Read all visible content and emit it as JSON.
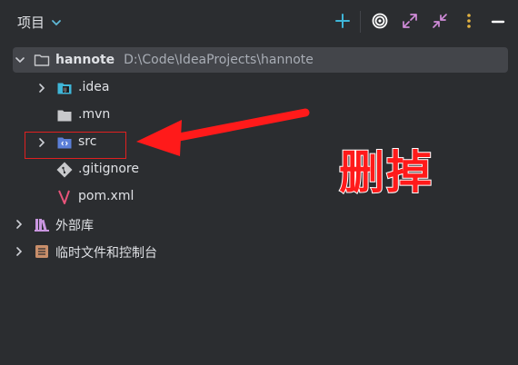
{
  "header": {
    "title": "项目"
  },
  "tree": {
    "root": {
      "name": "hannote",
      "path": "D:\\Code\\IdeaProjects\\hannote"
    },
    "items": [
      {
        "label": ".idea"
      },
      {
        "label": ".mvn"
      },
      {
        "label": "src"
      },
      {
        "label": ".gitignore"
      },
      {
        "label": "pom.xml"
      }
    ],
    "external_libs": "外部库",
    "scratches": "临时文件和控制台"
  },
  "annotation": {
    "text": "删掉"
  },
  "colors": {
    "background": "#2b2d30",
    "selected_row": "#43454a",
    "accent_plus": "#3fb6d8",
    "annotation_red": "#ff1a1a"
  }
}
